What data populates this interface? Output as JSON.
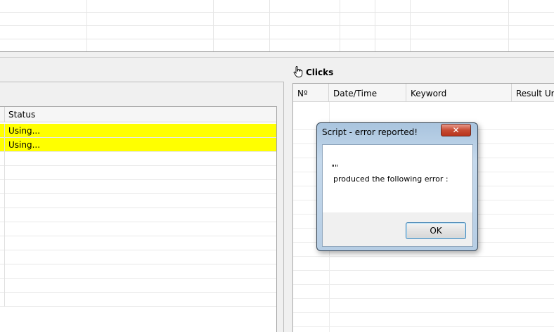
{
  "left_table": {
    "header_status": "Status",
    "rows": [
      {
        "status": "Using...",
        "highlight": true
      },
      {
        "status": "Using...",
        "highlight": true
      },
      {
        "status": "",
        "highlight": false
      },
      {
        "status": "",
        "highlight": false
      },
      {
        "status": "",
        "highlight": false
      },
      {
        "status": "",
        "highlight": false
      },
      {
        "status": "",
        "highlight": false
      },
      {
        "status": "",
        "highlight": false
      },
      {
        "status": "",
        "highlight": false
      },
      {
        "status": "",
        "highlight": false
      },
      {
        "status": "",
        "highlight": false
      },
      {
        "status": "",
        "highlight": false
      },
      {
        "status": "",
        "highlight": false
      }
    ],
    "highlight_color": "#ffff00"
  },
  "clicks_panel": {
    "title": "Clicks",
    "icon": "hand-pointer-icon",
    "columns": [
      "Nº",
      "Date/Time",
      "Keyword",
      "Result Url"
    ]
  },
  "dialog": {
    "title": "Script - error reported!",
    "close_label": "✕",
    "message_line1": "\"\"",
    "message_line2": "produced the following error :",
    "ok_label": "OK"
  }
}
